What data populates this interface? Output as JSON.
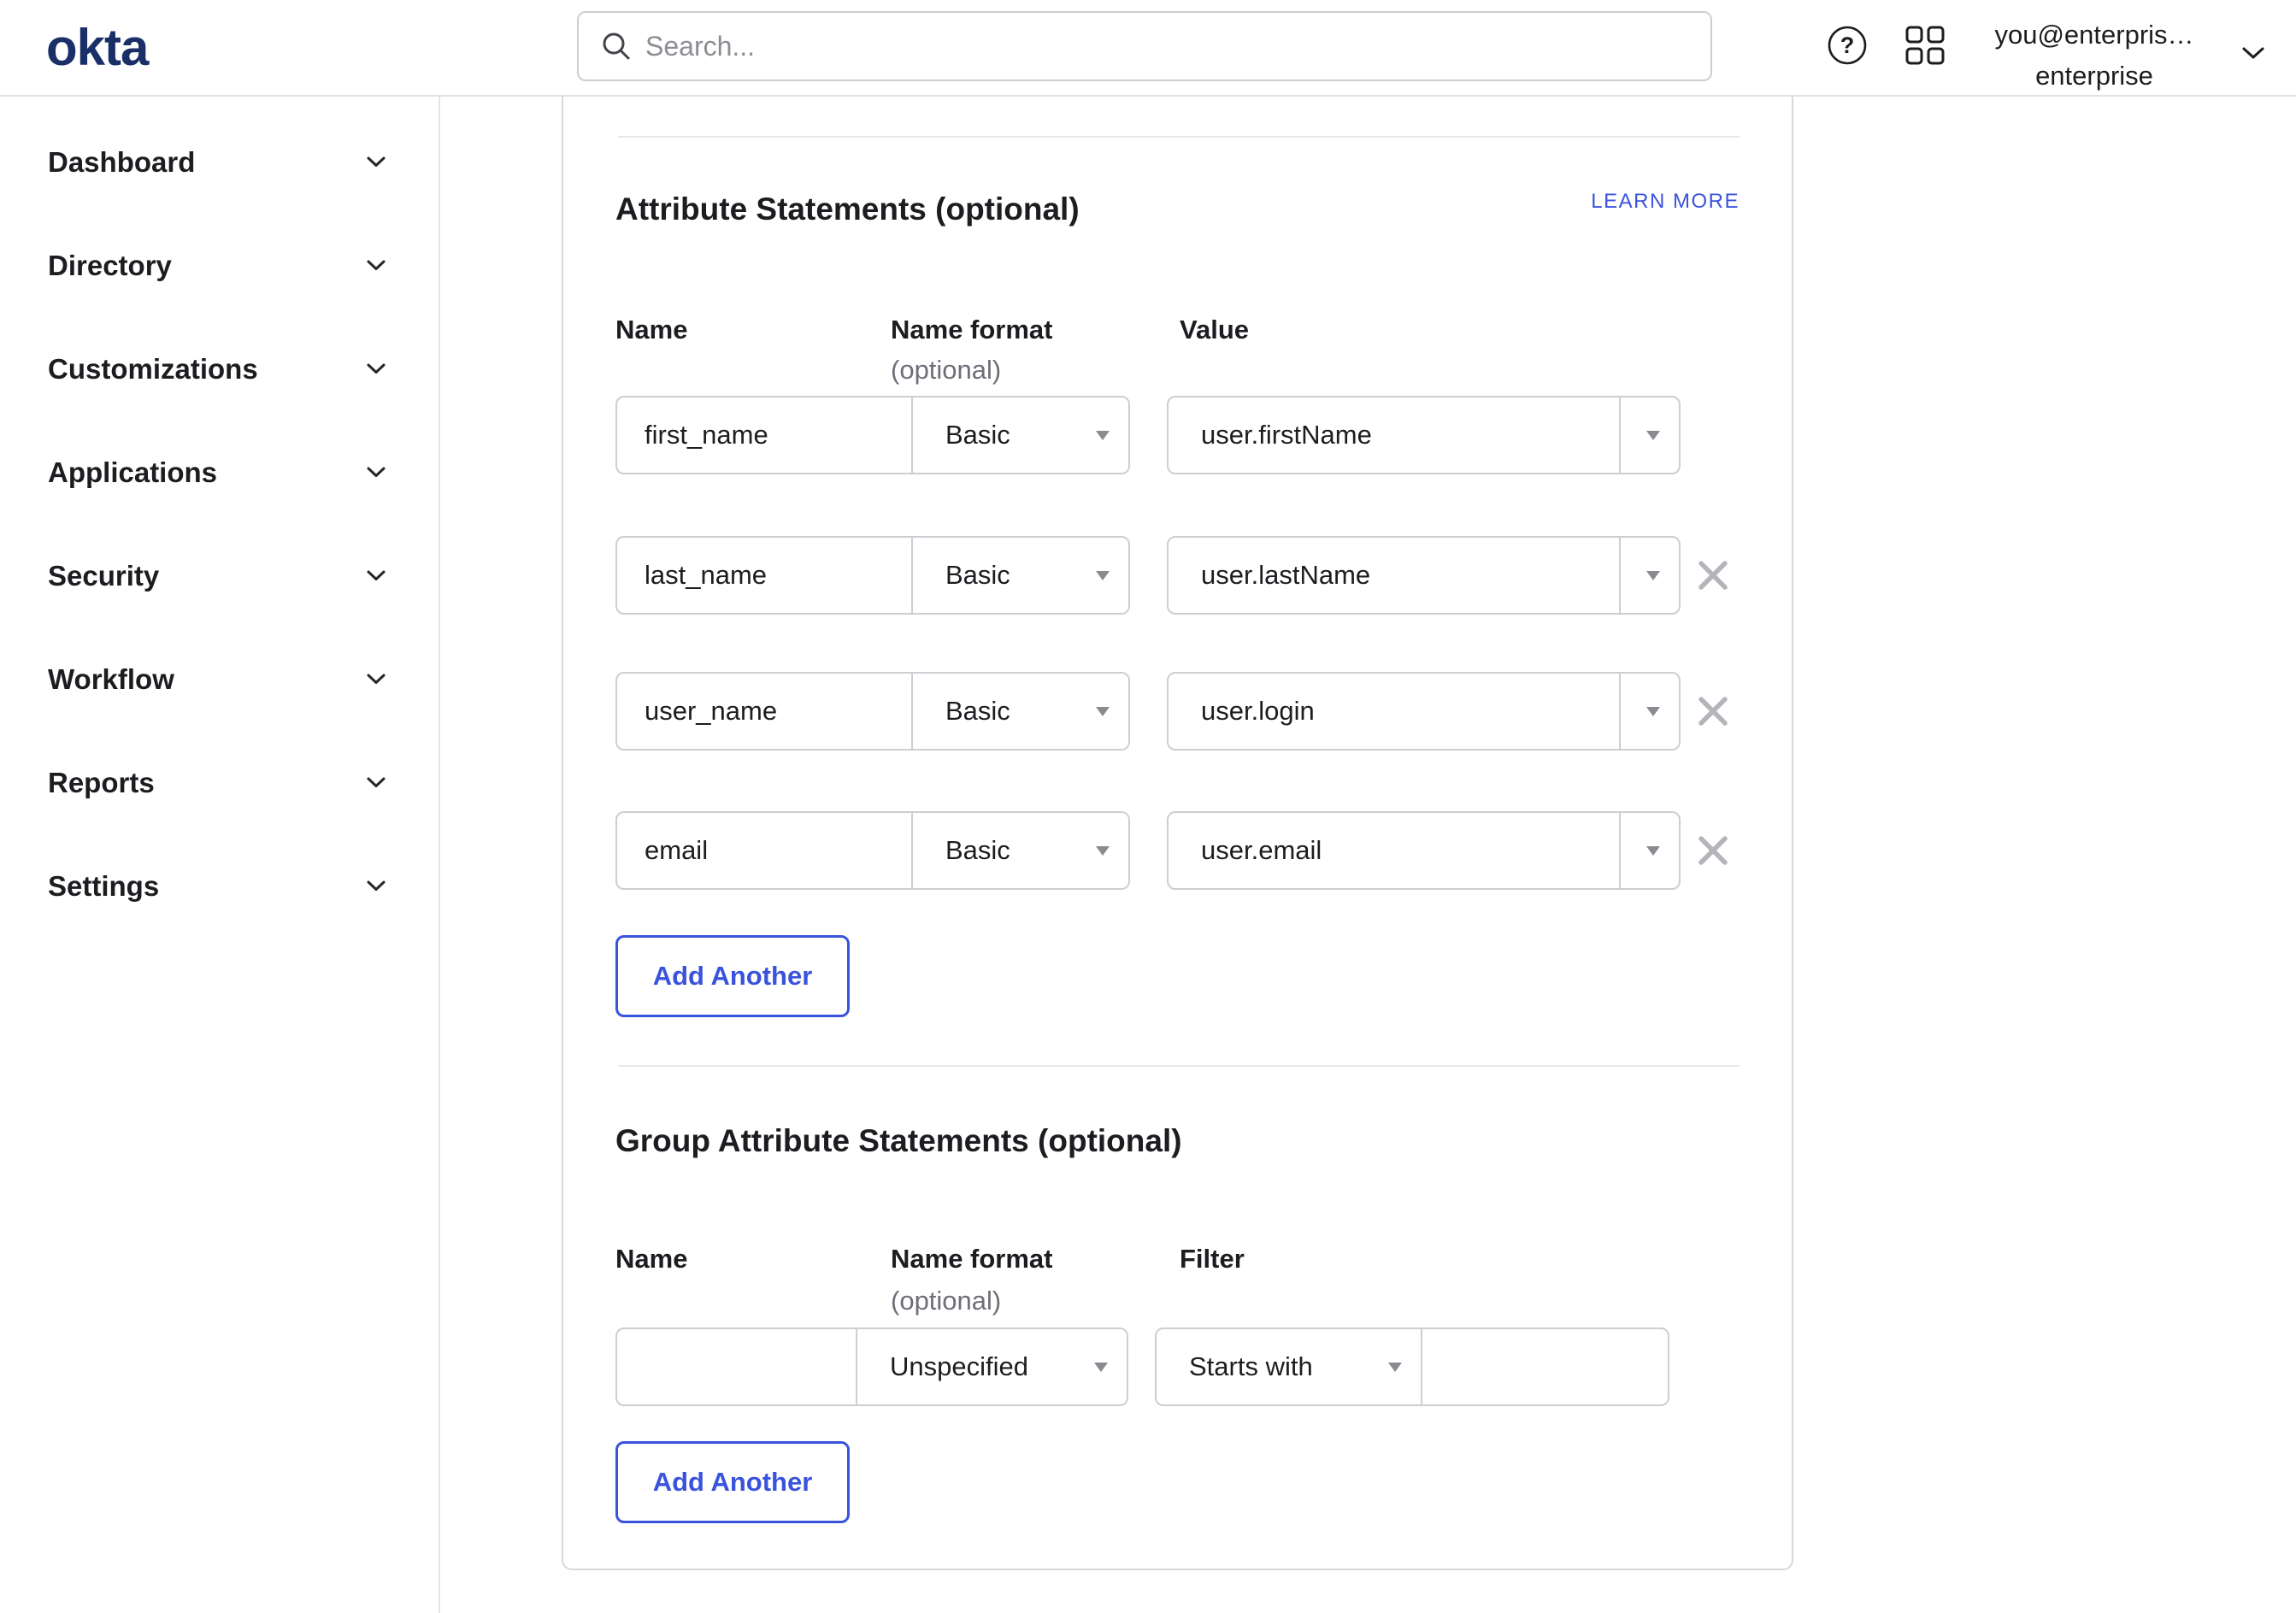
{
  "topbar": {
    "logo": "okta",
    "search_placeholder": "Search...",
    "user_line1": "you@enterpris…",
    "user_line2": "enterprise"
  },
  "sidebar": {
    "items": [
      {
        "label": "Dashboard"
      },
      {
        "label": "Directory"
      },
      {
        "label": "Customizations"
      },
      {
        "label": "Applications"
      },
      {
        "label": "Security"
      },
      {
        "label": "Workflow"
      },
      {
        "label": "Reports"
      },
      {
        "label": "Settings"
      }
    ]
  },
  "attribute_section": {
    "title": "Attribute Statements (optional)",
    "learn_more": "LEARN MORE",
    "columns": {
      "name": "Name",
      "name_format": "Name format",
      "optional": "(optional)",
      "value": "Value"
    },
    "rows": [
      {
        "name": "first_name",
        "format": "Basic",
        "value": "user.firstName"
      },
      {
        "name": "last_name",
        "format": "Basic",
        "value": "user.lastName"
      },
      {
        "name": "user_name",
        "format": "Basic",
        "value": "user.login"
      },
      {
        "name": "email",
        "format": "Basic",
        "value": "user.email"
      }
    ],
    "add_button": "Add Another"
  },
  "group_section": {
    "title": "Group Attribute Statements (optional)",
    "columns": {
      "name": "Name",
      "name_format": "Name format",
      "optional": "(optional)",
      "filter": "Filter"
    },
    "row": {
      "name": "",
      "format": "Unspecified",
      "filter_type": "Starts with",
      "filter_value": ""
    },
    "add_button": "Add Another"
  },
  "colors": {
    "accent_blue": "#3a53dc",
    "logo_navy": "#1a2f68",
    "text_primary": "#1d1d21",
    "text_secondary": "#6e6e78",
    "input_border": "#cdcdd3"
  }
}
